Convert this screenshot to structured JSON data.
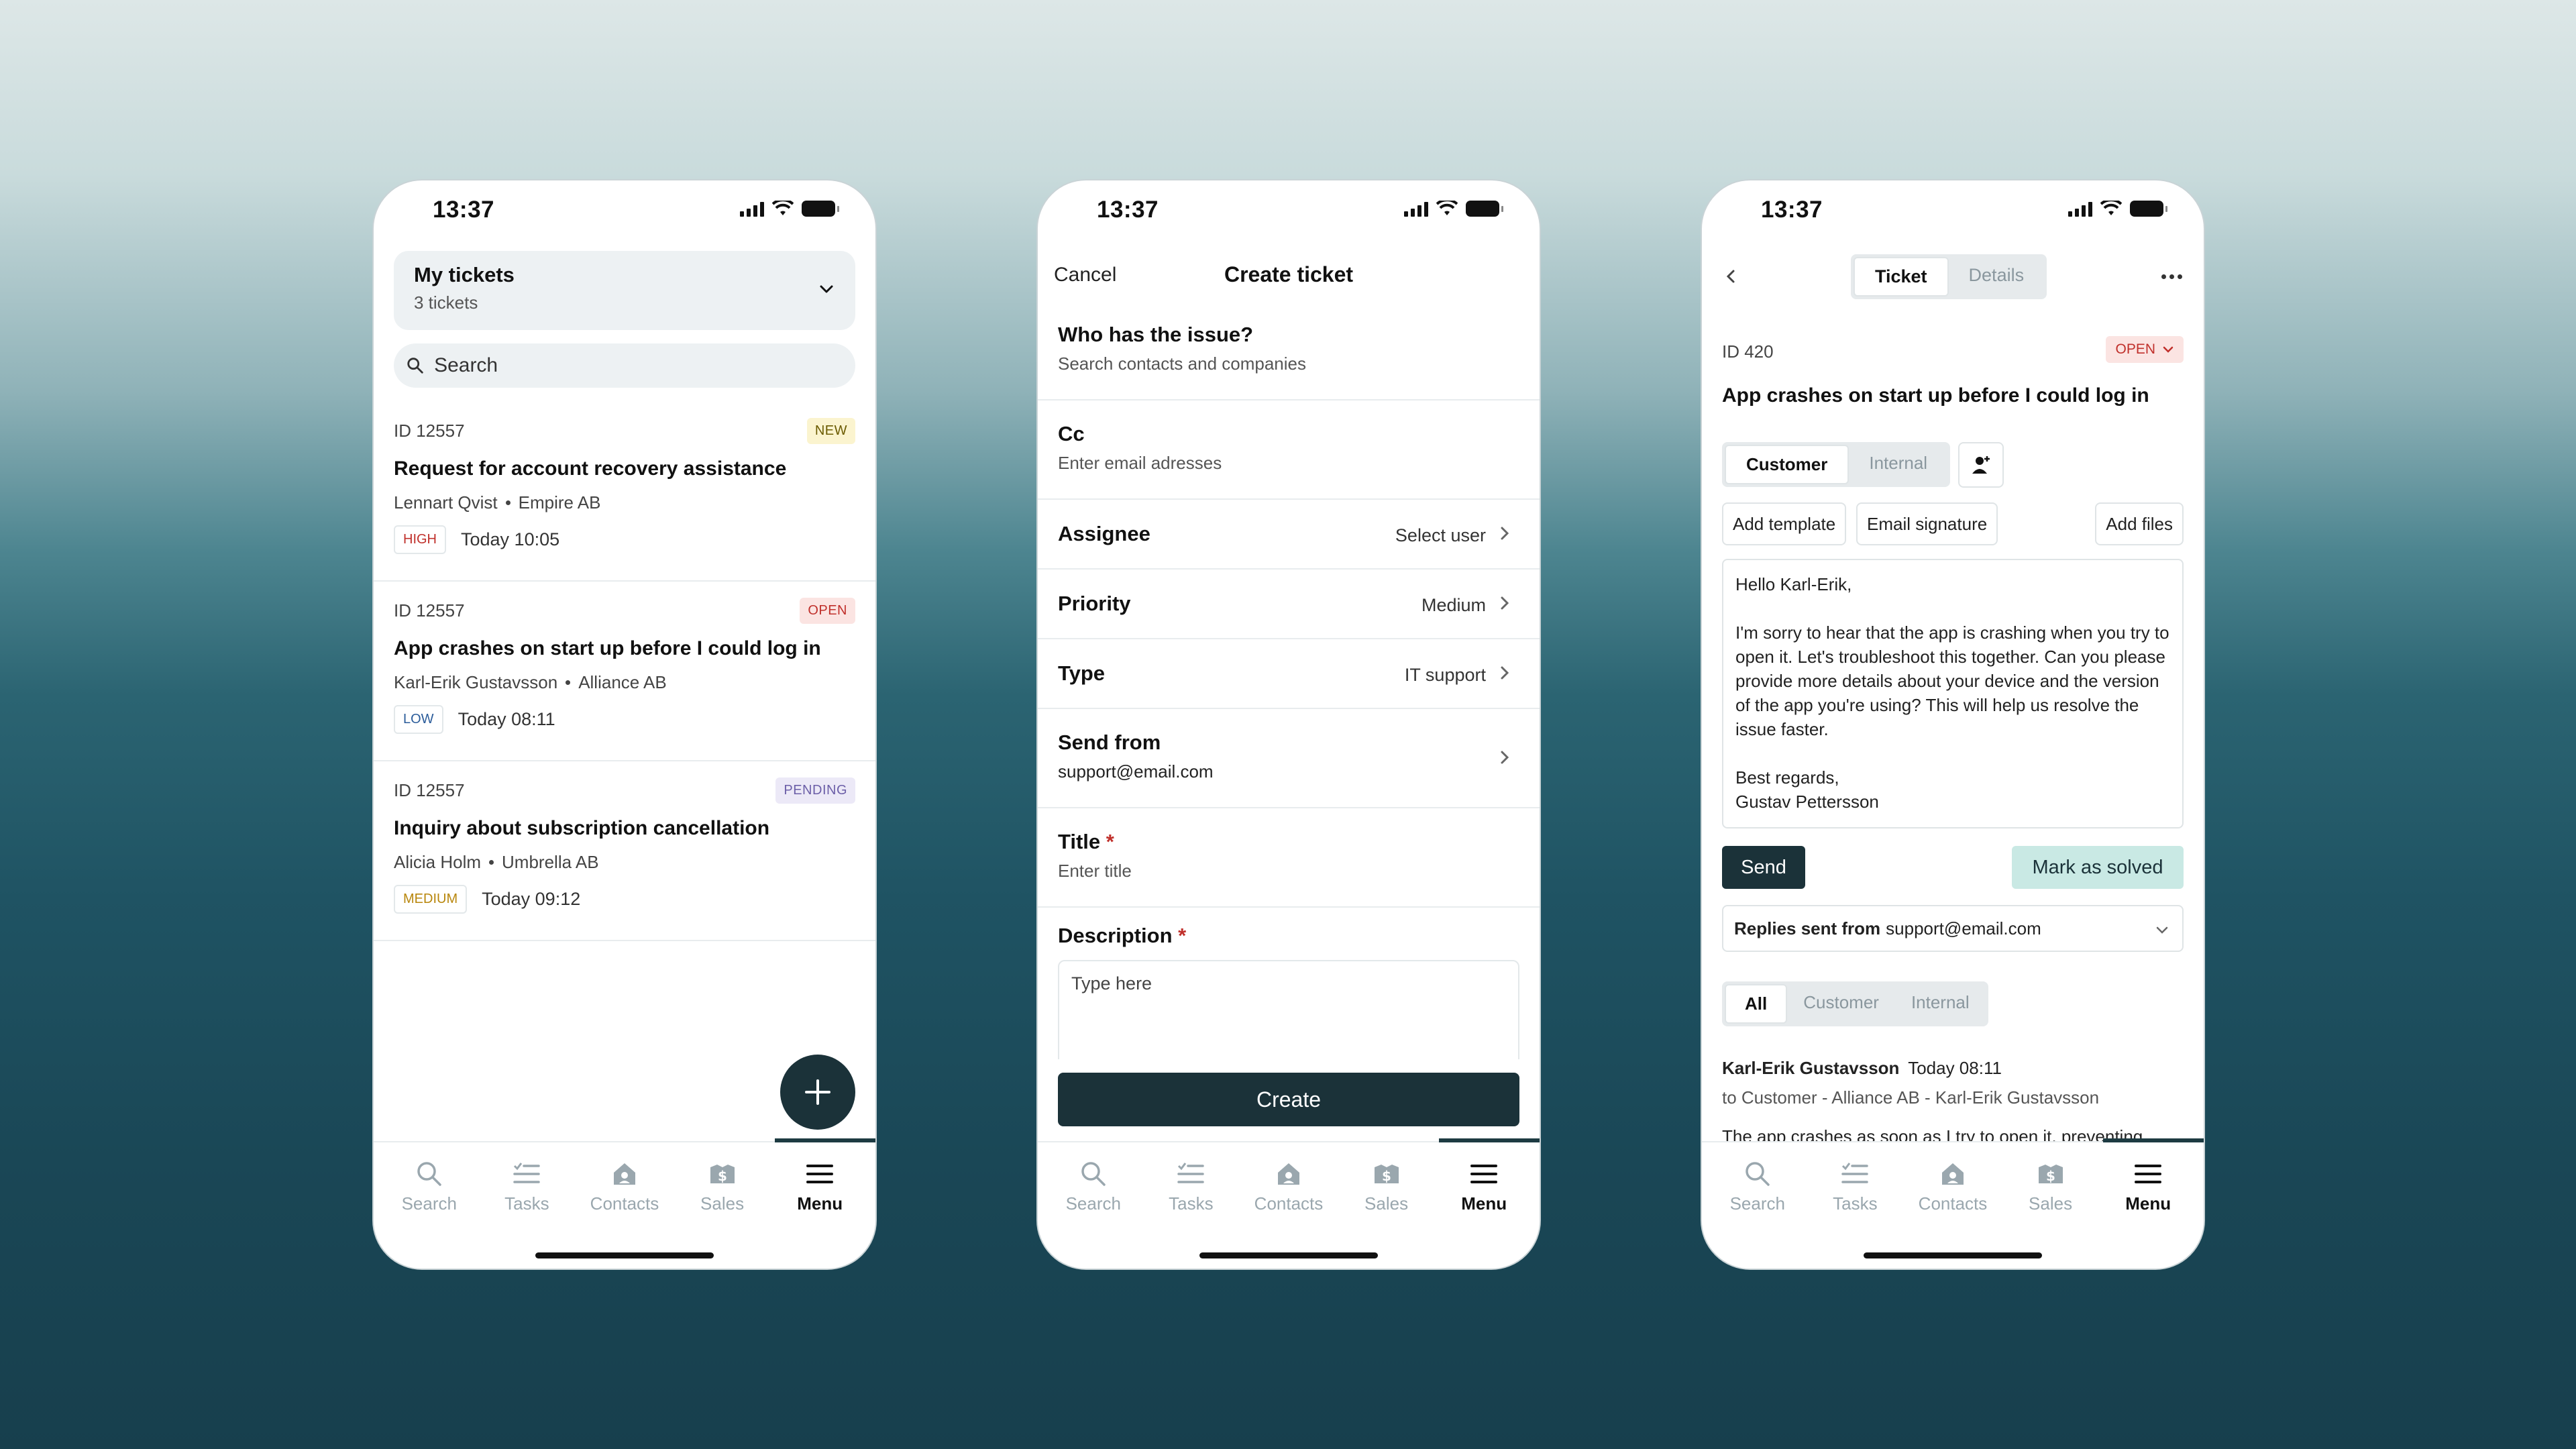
{
  "status": {
    "time": "13:37"
  },
  "nav": {
    "items": [
      {
        "label": "Search",
        "icon": "search-icon"
      },
      {
        "label": "Tasks",
        "icon": "tasks-icon"
      },
      {
        "label": "Contacts",
        "icon": "contacts-icon"
      },
      {
        "label": "Sales",
        "icon": "sales-icon"
      },
      {
        "label": "Menu",
        "icon": "menu-icon"
      }
    ]
  },
  "colors": {
    "dark": "#1b3239",
    "accent_light": "#c9e9e4",
    "open_red": "#c0302b",
    "new_yellow": "#6b5b00",
    "pending_purple": "#6c5fa8"
  },
  "tickets_screen": {
    "filter_title": "My tickets",
    "filter_count": "3 tickets",
    "search_placeholder": "Search",
    "tickets": [
      {
        "id": "ID 12557",
        "status": "NEW",
        "title": "Request for account recovery assistance",
        "contact": "Lennart Qvist",
        "company": "Empire AB",
        "priority": "HIGH",
        "time": "Today 10:05"
      },
      {
        "id": "ID 12557",
        "status": "OPEN",
        "title": "App crashes on start up before I could log in",
        "contact": "Karl-Erik Gustavsson",
        "company": "Alliance AB",
        "priority": "LOW",
        "time": "Today 08:11"
      },
      {
        "id": "ID 12557",
        "status": "PENDING",
        "title": "Inquiry about subscription cancellation",
        "contact": "Alicia Holm",
        "company": "Umbrella AB",
        "priority": "MEDIUM",
        "time": "Today 09:12"
      }
    ]
  },
  "create_screen": {
    "cancel": "Cancel",
    "title": "Create ticket",
    "who_label": "Who has the issue?",
    "who_placeholder": "Search contacts and companies",
    "cc_label": "Cc",
    "cc_placeholder": "Enter email adresses",
    "assignee_label": "Assignee",
    "assignee_value": "Select user",
    "priority_label": "Priority",
    "priority_value": "Medium",
    "type_label": "Type",
    "type_value": "IT support",
    "sendfrom_label": "Send from",
    "sendfrom_value": "support@email.com",
    "title_label": "Title",
    "title_placeholder": "Enter title",
    "desc_label": "Description",
    "desc_placeholder": "Type here",
    "required_mark": "*",
    "create_button": "Create"
  },
  "detail_screen": {
    "tab_ticket": "Ticket",
    "tab_details": "Details",
    "id": "ID 420",
    "status": "OPEN",
    "title": "App crashes on start up before I could log in",
    "seg_customer": "Customer",
    "seg_internal": "Internal",
    "add_template": "Add template",
    "email_signature": "Email signature",
    "add_files": "Add files",
    "compose": {
      "greeting": "Hello Karl-Erik,",
      "body": "I'm sorry to hear that the app is crashing when you try to open it. Let's troubleshoot this together. Can you please provide more details about your device and the version of the app you're using? This will help us resolve the issue faster.",
      "closing": "Best regards,",
      "signature": "Gustav Pettersson"
    },
    "send": "Send",
    "mark_solved": "Mark as solved",
    "replies_label": "Replies sent from",
    "replies_value": "support@email.com",
    "filter_all": "All",
    "filter_customer": "Customer",
    "filter_internal": "Internal",
    "message": {
      "author": "Karl-Erik Gustavsson",
      "time": "Today 08:11",
      "to": "to Customer - Alliance AB - Karl-Erik Gustavsson",
      "preview": "The app crashes as soon as I try to open it, preventing"
    }
  }
}
